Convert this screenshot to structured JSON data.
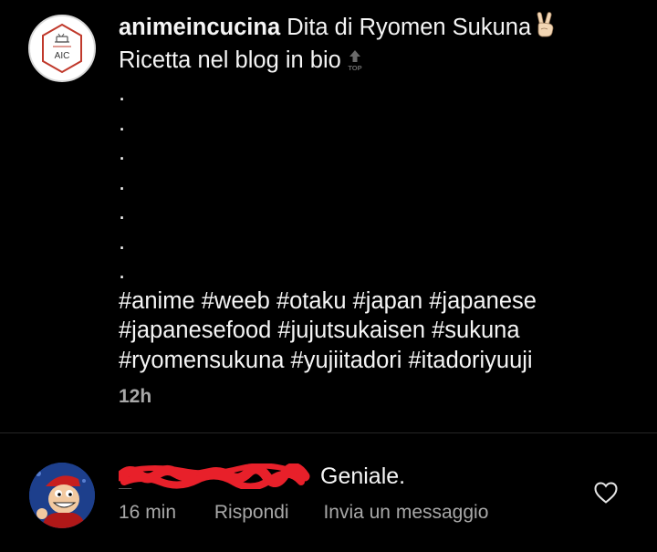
{
  "post": {
    "username": "animeincucina",
    "avatar_text": "AIC",
    "caption_line1": " Dita di Ryomen Sukuna",
    "caption_line2": "Ricetta nel blog in bio",
    "peace_emoji_icon": "victory-hand-icon",
    "top_emoji_icon": "top-arrow-icon",
    "top_emoji_label": "TOP",
    "dots": [
      ".",
      ".",
      ".",
      ".",
      ".",
      ".",
      "."
    ],
    "hashtags_line1": "#anime #weeb #otaku #japan #japanese",
    "hashtags_line2": "#japanesefood #jujutsukaisen #sukuna",
    "hashtags_line3": "#ryomensukuna #yujiitadori #itadoriyuuji",
    "timestamp": "12h"
  },
  "comment": {
    "username_redacted": "_",
    "text": "Geniale.",
    "time": "16 min",
    "reply_label": "Rispondi",
    "message_label": "Invia un messaggio",
    "like_icon": "heart-outline-icon"
  },
  "colors": {
    "background": "#000000",
    "text_primary": "#f5f5f5",
    "text_secondary": "#a8a8a8",
    "divider": "#262626",
    "redaction": "#e8202a",
    "logo_accent": "#c0392b"
  }
}
